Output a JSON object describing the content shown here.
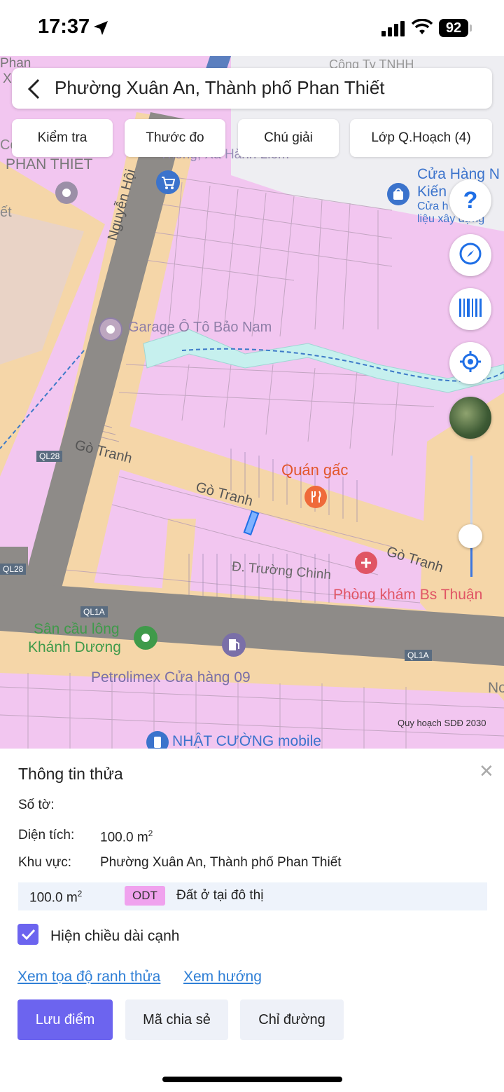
{
  "status_bar": {
    "time": "17:37",
    "battery": "92"
  },
  "header": {
    "title": "Phường Xuân An, Thành phố Phan Thiết"
  },
  "toolbar": {
    "check_label": "Kiểm tra",
    "measure_label": "Thước đo",
    "legend_label": "Chú giải",
    "layers_label": "Lớp Q.Hoạch (4)"
  },
  "map": {
    "labels": {
      "phan": "Phan",
      "x": "X",
      "ct": "Công Ty TNHH",
      "phan_thiet": "PHAN THIET",
      "co": "Cô",
      "et": "ết",
      "cua_hang": "Cửa Hàng N",
      "kien": "Kiến",
      "cua_h": "Cửa h",
      "lieu_xay_dung": "liệu xây dựng",
      "thong_xa_hanh_liem": "Thống, Xa Hành Liêm",
      "nguyen_hoi": "Nguyễn Hội",
      "garage": "Garage Ô Tô Bảo Nam",
      "go_tranh_1": "Gò Tranh",
      "go_tranh_2": "Gò Tranh",
      "go_tranh_3": "Gò Tranh",
      "quan_gac": "Quán gấc",
      "truong_chinh": "Đ. Trường Chinh",
      "phong_kham": "Phòng khám Bs Thuận",
      "ql28_1": "QL28",
      "ql28_2": "QL28",
      "ql1a_1": "QL1A",
      "ql1a_2": "QL1A",
      "san_cau_long": "Sân cầu lông",
      "khanh_duong": "Khánh Dương",
      "petrolimex": "Petrolimex Cửa hàng 09",
      "nhat_cuong": "NHẬT CƯỜNG mobile",
      "no": "No"
    },
    "attribution": "Quy hoạch SDĐ 2030",
    "colors": {
      "residential": "#f2c6f0",
      "road_band": "#f5d6a8",
      "road": "#8e8b88",
      "water": "#c6f0ee",
      "accent": "#1f6fe6"
    }
  },
  "parcel_info": {
    "heading": "Thông tin thửa",
    "sheet_label": "Số tờ:",
    "area_label": "Diện tích:",
    "area_value": "100.0 m",
    "area_sup": "2",
    "region_label": "Khu vực:",
    "region_value": "Phường Xuân An, Thành phố Phan Thiết",
    "land_area": "100.0 m",
    "land_area_sup": "2",
    "land_code": "ODT",
    "land_type": "Đất ở tại đô thị",
    "show_edges_label": "Hiện chiều dài cạnh",
    "show_edges_checked": true,
    "coords_link": "Xem tọa độ ranh thửa",
    "direction_link": "Xem hướng",
    "save_button": "Lưu điểm",
    "share_button": "Mã chia sẻ",
    "route_button": "Chỉ đường"
  }
}
